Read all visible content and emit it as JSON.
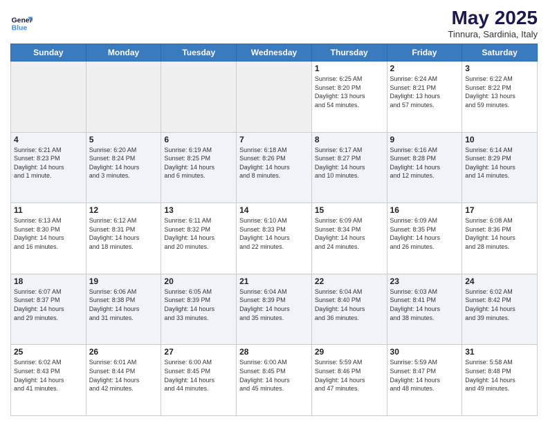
{
  "header": {
    "logo_line1": "General",
    "logo_line2": "Blue",
    "month_year": "May 2025",
    "location": "Tinnura, Sardinia, Italy"
  },
  "days_of_week": [
    "Sunday",
    "Monday",
    "Tuesday",
    "Wednesday",
    "Thursday",
    "Friday",
    "Saturday"
  ],
  "weeks": [
    [
      {
        "day": "",
        "text": ""
      },
      {
        "day": "",
        "text": ""
      },
      {
        "day": "",
        "text": ""
      },
      {
        "day": "",
        "text": ""
      },
      {
        "day": "1",
        "text": "Sunrise: 6:25 AM\nSunset: 8:20 PM\nDaylight: 13 hours\nand 54 minutes."
      },
      {
        "day": "2",
        "text": "Sunrise: 6:24 AM\nSunset: 8:21 PM\nDaylight: 13 hours\nand 57 minutes."
      },
      {
        "day": "3",
        "text": "Sunrise: 6:22 AM\nSunset: 8:22 PM\nDaylight: 13 hours\nand 59 minutes."
      }
    ],
    [
      {
        "day": "4",
        "text": "Sunrise: 6:21 AM\nSunset: 8:23 PM\nDaylight: 14 hours\nand 1 minute."
      },
      {
        "day": "5",
        "text": "Sunrise: 6:20 AM\nSunset: 8:24 PM\nDaylight: 14 hours\nand 3 minutes."
      },
      {
        "day": "6",
        "text": "Sunrise: 6:19 AM\nSunset: 8:25 PM\nDaylight: 14 hours\nand 6 minutes."
      },
      {
        "day": "7",
        "text": "Sunrise: 6:18 AM\nSunset: 8:26 PM\nDaylight: 14 hours\nand 8 minutes."
      },
      {
        "day": "8",
        "text": "Sunrise: 6:17 AM\nSunset: 8:27 PM\nDaylight: 14 hours\nand 10 minutes."
      },
      {
        "day": "9",
        "text": "Sunrise: 6:16 AM\nSunset: 8:28 PM\nDaylight: 14 hours\nand 12 minutes."
      },
      {
        "day": "10",
        "text": "Sunrise: 6:14 AM\nSunset: 8:29 PM\nDaylight: 14 hours\nand 14 minutes."
      }
    ],
    [
      {
        "day": "11",
        "text": "Sunrise: 6:13 AM\nSunset: 8:30 PM\nDaylight: 14 hours\nand 16 minutes."
      },
      {
        "day": "12",
        "text": "Sunrise: 6:12 AM\nSunset: 8:31 PM\nDaylight: 14 hours\nand 18 minutes."
      },
      {
        "day": "13",
        "text": "Sunrise: 6:11 AM\nSunset: 8:32 PM\nDaylight: 14 hours\nand 20 minutes."
      },
      {
        "day": "14",
        "text": "Sunrise: 6:10 AM\nSunset: 8:33 PM\nDaylight: 14 hours\nand 22 minutes."
      },
      {
        "day": "15",
        "text": "Sunrise: 6:09 AM\nSunset: 8:34 PM\nDaylight: 14 hours\nand 24 minutes."
      },
      {
        "day": "16",
        "text": "Sunrise: 6:09 AM\nSunset: 8:35 PM\nDaylight: 14 hours\nand 26 minutes."
      },
      {
        "day": "17",
        "text": "Sunrise: 6:08 AM\nSunset: 8:36 PM\nDaylight: 14 hours\nand 28 minutes."
      }
    ],
    [
      {
        "day": "18",
        "text": "Sunrise: 6:07 AM\nSunset: 8:37 PM\nDaylight: 14 hours\nand 29 minutes."
      },
      {
        "day": "19",
        "text": "Sunrise: 6:06 AM\nSunset: 8:38 PM\nDaylight: 14 hours\nand 31 minutes."
      },
      {
        "day": "20",
        "text": "Sunrise: 6:05 AM\nSunset: 8:39 PM\nDaylight: 14 hours\nand 33 minutes."
      },
      {
        "day": "21",
        "text": "Sunrise: 6:04 AM\nSunset: 8:39 PM\nDaylight: 14 hours\nand 35 minutes."
      },
      {
        "day": "22",
        "text": "Sunrise: 6:04 AM\nSunset: 8:40 PM\nDaylight: 14 hours\nand 36 minutes."
      },
      {
        "day": "23",
        "text": "Sunrise: 6:03 AM\nSunset: 8:41 PM\nDaylight: 14 hours\nand 38 minutes."
      },
      {
        "day": "24",
        "text": "Sunrise: 6:02 AM\nSunset: 8:42 PM\nDaylight: 14 hours\nand 39 minutes."
      }
    ],
    [
      {
        "day": "25",
        "text": "Sunrise: 6:02 AM\nSunset: 8:43 PM\nDaylight: 14 hours\nand 41 minutes."
      },
      {
        "day": "26",
        "text": "Sunrise: 6:01 AM\nSunset: 8:44 PM\nDaylight: 14 hours\nand 42 minutes."
      },
      {
        "day": "27",
        "text": "Sunrise: 6:00 AM\nSunset: 8:45 PM\nDaylight: 14 hours\nand 44 minutes."
      },
      {
        "day": "28",
        "text": "Sunrise: 6:00 AM\nSunset: 8:45 PM\nDaylight: 14 hours\nand 45 minutes."
      },
      {
        "day": "29",
        "text": "Sunrise: 5:59 AM\nSunset: 8:46 PM\nDaylight: 14 hours\nand 47 minutes."
      },
      {
        "day": "30",
        "text": "Sunrise: 5:59 AM\nSunset: 8:47 PM\nDaylight: 14 hours\nand 48 minutes."
      },
      {
        "day": "31",
        "text": "Sunrise: 5:58 AM\nSunset: 8:48 PM\nDaylight: 14 hours\nand 49 minutes."
      }
    ]
  ]
}
